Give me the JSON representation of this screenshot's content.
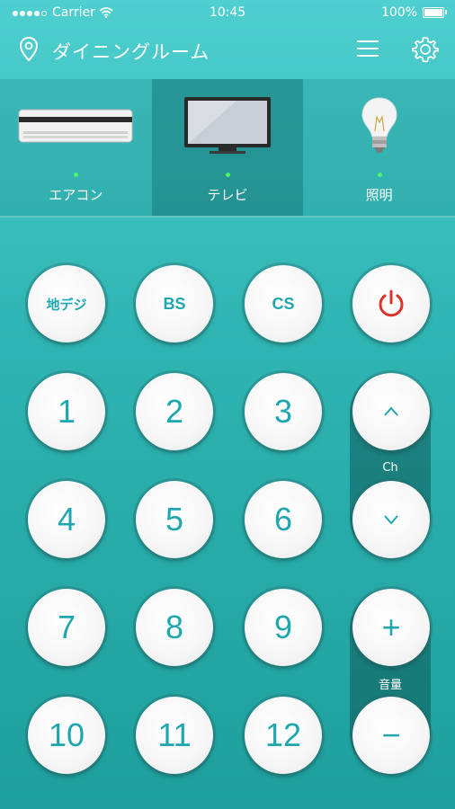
{
  "status_bar": {
    "carrier": "Carrier",
    "time": "10:45",
    "battery": "100%"
  },
  "header": {
    "room_name": "ダイニングルーム"
  },
  "devices": [
    {
      "label": "エアコン",
      "active": false
    },
    {
      "label": "テレビ",
      "active": true
    },
    {
      "label": "照明",
      "active": false
    }
  ],
  "remote": {
    "input_buttons": [
      "地デジ",
      "BS",
      "CS"
    ],
    "numbers": [
      "1",
      "2",
      "3",
      "4",
      "5",
      "6",
      "7",
      "8",
      "9",
      "10",
      "11",
      "12"
    ],
    "channel_label": "Ch",
    "volume_label": "音量",
    "volume_up": "+",
    "volume_down": "−"
  },
  "colors": {
    "accent": "#1fa7b0",
    "power": "#e0322c",
    "indicator": "#4df56a"
  }
}
